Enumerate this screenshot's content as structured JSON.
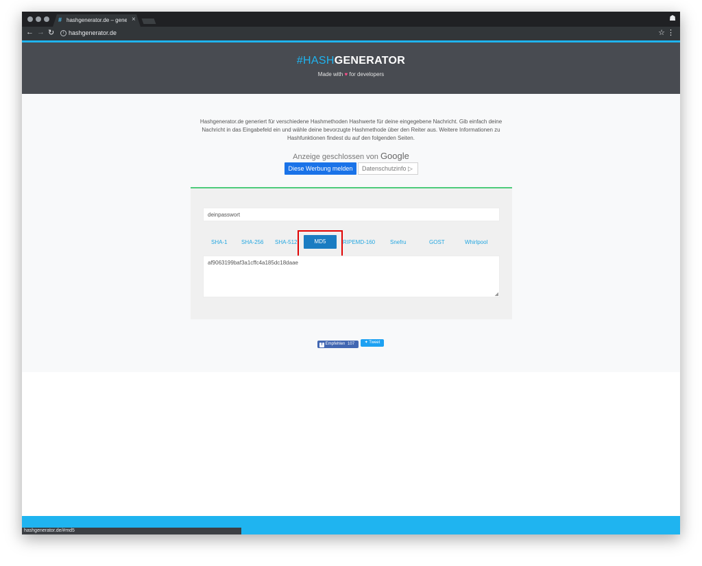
{
  "browser": {
    "tab_title": "hashgenerator.de – generate",
    "tab_favicon": "#",
    "url": "hashgenerator.de",
    "status_url": "hashgenerator.de/#md5"
  },
  "header": {
    "brand_hash": "#HASH",
    "brand_generator": "GENERATOR",
    "tagline_before": "Made with",
    "tagline_after": "for developers"
  },
  "intro": {
    "text": "Hashgenerator.de generiert für verschiedene Hashmethoden Hashwerte für deine eingegebene Nachricht. Gib einfach deine Nachricht in das Eingabefeld ein und wähle deine bevorzugte Hashmethode über den Reiter aus. Weitere Informationen zu Hashfunktionen findest du auf den folgenden Seiten."
  },
  "ad": {
    "closed_text": "Anzeige geschlossen von",
    "google": "Google",
    "report_label": "Diese Werbung melden",
    "privacy_label": "Datenschutzinfo ▷"
  },
  "hash": {
    "input_value": "deinpasswort",
    "methods": [
      "SHA-1",
      "SHA-256",
      "SHA-512",
      "MD5",
      "RIPEMD-160",
      "Snefru",
      "GOST",
      "Whirlpool"
    ],
    "active_method": "MD5",
    "output_value": "af9063199baf3a1cffc4a185dc18daae"
  },
  "share": {
    "fb_icon": "f",
    "fb_label": "Empfehlen",
    "fb_count": "107",
    "tweet_label": "Tweet"
  },
  "colors": {
    "accent": "#1fb4f0",
    "header_bg": "#484b51",
    "active_tab": "#1a7cc2",
    "panel_border": "#4ccb7a",
    "highlight": "#e00000"
  }
}
